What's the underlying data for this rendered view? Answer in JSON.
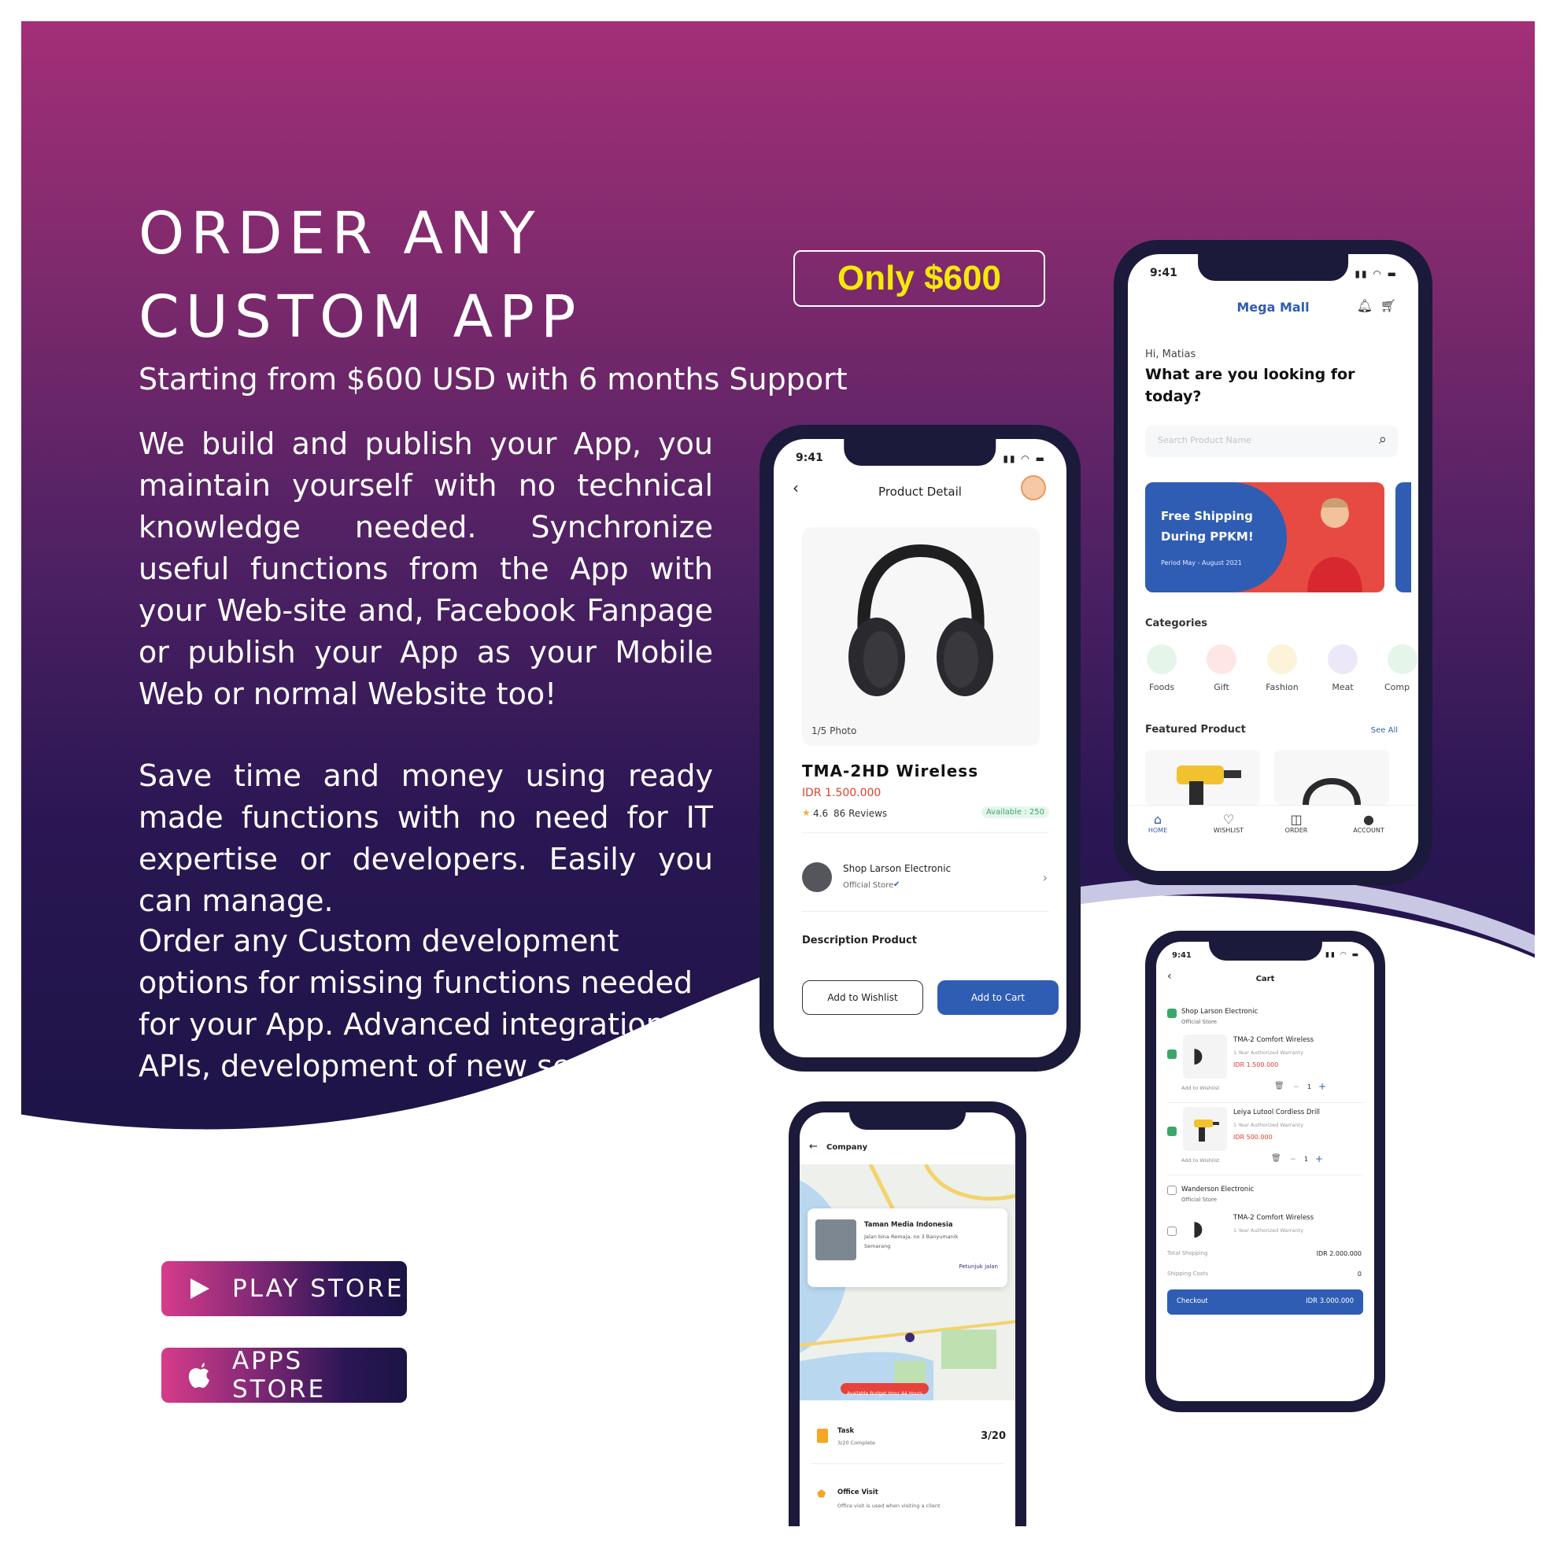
{
  "heading": {
    "line1": "ORDER ANY",
    "line2": "CUSTOM APP"
  },
  "subtitle": "Starting from $600 USD with 6 months Support",
  "price_badge": "Only $600",
  "paragraphs": [
    "We build and publish your App, you maintain yourself with no technical knowledge needed. Synchronize useful functions from the App with your Web-site and, Facebook Fanpage or publish your App as your Mobile Web or normal Website too!",
    "Save time and money using ready made functions with no need for IT expertise or developers. Easily you can manage.",
    "Order any Custom development options for missing functions needed for your App. Advanced integrations, APIs, development of new services."
  ],
  "store_buttons": {
    "play": "PLAY STORE",
    "apple": "APPS STORE"
  },
  "colors": {
    "accent_yellow": "#f5e90a",
    "gradient_top": "#a32f78",
    "gradient_bottom": "#1d1447",
    "app_blue": "#2f5db3",
    "price_red": "#e0402f"
  },
  "phone_product": {
    "time": "9:41",
    "header": "Product Detail",
    "photo_counter": "1/5 Photo",
    "product_name": "TMA-2HD Wireless",
    "price": "IDR 1.500.000",
    "rating": "4.6",
    "reviews": "86 Reviews",
    "available": "Available : 250",
    "shop_name": "Shop Larson Electronic",
    "shop_type": "Official Store",
    "description_title": "Description Product",
    "wishlist_btn": "Add to Wishlist",
    "cart_btn": "Add to Cart"
  },
  "phone_home": {
    "time": "9:41",
    "brand": "Mega Mall",
    "greeting": "Hi, Matias",
    "question_line1": "What are you looking for",
    "question_line2": "today?",
    "search_placeholder": "Search Product Name",
    "banner_line1": "Free Shipping",
    "banner_line2": "During PPKM!",
    "banner_period": "Period May - August 2021",
    "categories_title": "Categories",
    "categories": [
      "Foods",
      "Gift",
      "Fashion",
      "Meat",
      "Comp"
    ],
    "featured_title": "Featured Product",
    "see_all": "See All",
    "nav": [
      "HOME",
      "WISHLIST",
      "ORDER",
      "ACCOUNT"
    ]
  },
  "phone_cart": {
    "time": "9:41",
    "header": "Cart",
    "shop1": "Shop Larson Electronic",
    "shop1_type": "Official Store",
    "item1_name": "TMA-2 Comfort Wireless",
    "item1_warranty": "1 Year Authorized Warranty",
    "item1_price": "IDR 1.500.000",
    "item2_name": "Leiya Lutool Cordless Drill",
    "item2_warranty": "1 Year Authorized Warranty",
    "item2_price": "IDR 500.000",
    "add_wishlist": "Add to Wishlist",
    "qty": "1",
    "shop2": "Wanderson Electronic",
    "shop2_type": "Official Store",
    "item3_name": "TMA-2 Comfort Wireless",
    "item3_warranty": "1 Year Authorized Warranty",
    "total_label": "Total Shopping",
    "total_value": "IDR 2.000.000",
    "shipping_label": "Shipping Costs",
    "shipping_value": "0",
    "checkout_label": "Checkout",
    "checkout_value": "IDR 3.000.000"
  },
  "phone_map": {
    "header": "Company",
    "company_name": "Taman Media Indonesia",
    "address_line1": "Jalan bina Remaja, no 3 Banyumanik",
    "address_line2": "Semarang",
    "directions": "Petunjuk jalan",
    "budget_badge": "Available Budget Hour 44 Hours",
    "task_title": "Task",
    "task_sub": "3/20 Complete",
    "task_count": "3/20",
    "visit_title": "Office Visit",
    "visit_sub": "Office visit is used when visiting a client"
  }
}
